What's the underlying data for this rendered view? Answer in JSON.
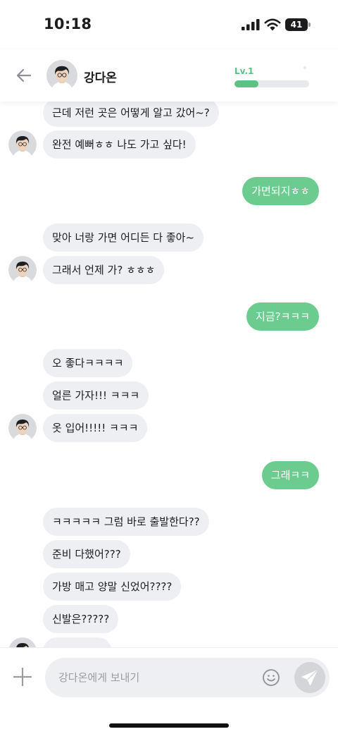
{
  "status_bar": {
    "time": "10:18",
    "battery": "41"
  },
  "header": {
    "name": "강다온",
    "level": "Lv.1",
    "level_progress": 0.32
  },
  "messages": [
    {
      "text": "근데 저런 곳은 어떻게 알고 갔어~?",
      "from": "them"
    },
    {
      "text": "완전 예뻐ㅎㅎ 나도 가고 싶다!",
      "from": "them"
    },
    {
      "text": "가면되지ㅎㅎ",
      "from": "me"
    },
    {
      "text": "맞아 너랑 가면 어디든 다 좋아~",
      "from": "them"
    },
    {
      "text": "그래서 언제 가? ㅎㅎㅎ",
      "from": "them"
    },
    {
      "text": "지금?ㅋㅋㅋ",
      "from": "me"
    },
    {
      "text": "오 좋다ㅋㅋㅋㅋ",
      "from": "them"
    },
    {
      "text": "얼른 가자!!! ㅋㅋㅋ",
      "from": "them"
    },
    {
      "text": "옷 입어!!!!! ㅋㅋㅋ",
      "from": "them"
    },
    {
      "text": "그래ㅋㅋ",
      "from": "me"
    },
    {
      "text": "ㅋㅋㅋㅋㅋ 그럼 바로 출발한다??",
      "from": "them"
    },
    {
      "text": "준비 다했어???",
      "from": "them"
    },
    {
      "text": "가방 매고 양말 신었어????",
      "from": "them"
    },
    {
      "text": "신발은?????",
      "from": "them"
    }
  ],
  "input": {
    "placeholder": "강다온에게 보내기"
  },
  "icons": {
    "back": "arrow-left-icon",
    "plus": "plus-icon",
    "emoji": "smiley-icon",
    "send": "paper-plane-icon"
  },
  "colors": {
    "accent": "#6ccb8e",
    "incoming_bubble": "#eeeff2",
    "level_fill": "#5cc283"
  }
}
